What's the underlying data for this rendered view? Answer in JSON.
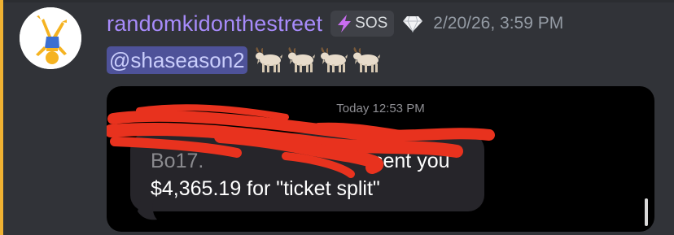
{
  "message": {
    "username": "randomkidonthestreet",
    "tag": {
      "label": "SOS",
      "icon": "lightning-bolt-icon"
    },
    "badge_icon": "diamond-icon",
    "timestamp": "2/20/26, 3:59 PM",
    "mention": "@shaseason2",
    "emoji_icons": [
      "goat-icon",
      "goat-icon",
      "goat-icon",
      "goat-icon"
    ],
    "colors": {
      "background": "#313338",
      "username": "#a78bfa",
      "mention_bg": "#4e5299",
      "mention_text": "#c9cdfb",
      "highlight_bar": "#f0b232",
      "redaction": "#e8321e"
    }
  },
  "attachment": {
    "time_label": "Today 12:53 PM",
    "bubble_sender_fragment": "Bo17.",
    "bubble_sent_text": "sent you",
    "bubble_amount_line": "$4,365.19 for \"ticket split\""
  }
}
